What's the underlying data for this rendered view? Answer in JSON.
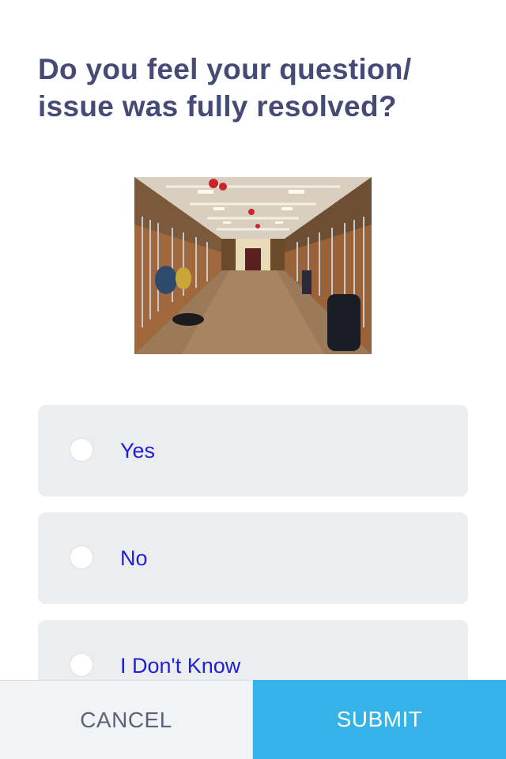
{
  "survey": {
    "question": "Do you feel your question/ issue was fully resolved?",
    "image": {
      "description_icon": "stable-aisle-photo"
    },
    "options": [
      {
        "label": "Yes",
        "selected": false
      },
      {
        "label": "No",
        "selected": false
      },
      {
        "label": "I Don't Know",
        "selected": false
      }
    ]
  },
  "footer": {
    "cancel_label": "CANCEL",
    "submit_label": "SUBMIT"
  },
  "colors": {
    "question_text": "#454a76",
    "option_background": "#ecedef",
    "option_text": "#1f1fd6",
    "cancel_background": "#f2f3f5",
    "cancel_text": "#5a6378",
    "submit_background": "#35b2e8",
    "submit_text": "#ffffff"
  }
}
